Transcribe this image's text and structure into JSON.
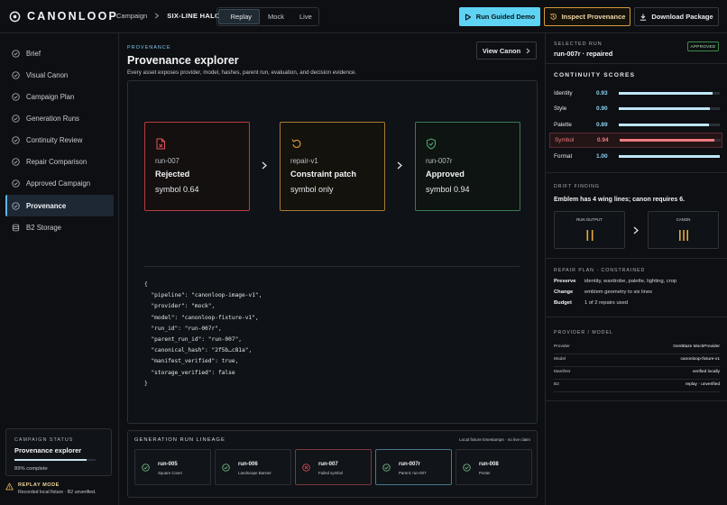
{
  "app": {
    "name": "CANONLOOP"
  },
  "breadcrumb": {
    "root": "Campaign",
    "current": "SIX-LINE HALO"
  },
  "modes": {
    "replay": "Replay",
    "mock": "Mock",
    "live": "Live",
    "active": "Replay"
  },
  "actions": {
    "guided": "Run Guided Demo",
    "inspect": "Inspect Provenance",
    "download": "Download Package"
  },
  "sidebar": {
    "items": [
      {
        "label": "Brief"
      },
      {
        "label": "Visual Canon"
      },
      {
        "label": "Campaign Plan"
      },
      {
        "label": "Generation Runs"
      },
      {
        "label": "Continuity Review"
      },
      {
        "label": "Repair Comparison"
      },
      {
        "label": "Approved Campaign"
      },
      {
        "label": "Provenance"
      },
      {
        "label": "B2 Storage"
      }
    ],
    "active": "Provenance",
    "status": {
      "kicker": "CAMPAIGN STATUS",
      "title": "Provenance explorer",
      "progress": 0.89,
      "progress_text": "89% complete"
    },
    "replay": {
      "title": "REPLAY MODE",
      "sub": "Recorded local fixture · B2 unverified."
    }
  },
  "main": {
    "kicker": "PROVENANCE",
    "title": "Provenance explorer",
    "subtitle": "Every asset exposes provider, model, hashes, parent run, evaluation, and decision evidence.",
    "view_canon": "View Canon",
    "cards": [
      {
        "run": "run-007",
        "title": "Rejected",
        "value": "symbol 0.64",
        "tone": "red"
      },
      {
        "run": "repair-v1",
        "title": "Constraint patch",
        "value": "symbol only",
        "tone": "amber"
      },
      {
        "run": "run-007r",
        "title": "Approved",
        "value": "symbol 0.94",
        "tone": "green"
      }
    ],
    "json_lines": [
      "{",
      "  \"pipeline\": \"canonloop-image-v1\",",
      "  \"provider\": \"mock\",",
      "  \"model\": \"canonloop-fixture-v1\",",
      "  \"run_id\": \"run-007r\",",
      "  \"parent_run_id\": \"run-007\",",
      "  \"canonical_hash\": \"2f5b…c81a\",",
      "  \"manifest_verified\": true,",
      "  \"storage_verified\": false",
      "}"
    ]
  },
  "lineage": {
    "title": "GENERATION RUN LINEAGE",
    "note": "Local fixture timestamps · no live claim",
    "runs": [
      {
        "id": "run-005",
        "sub": "Square Cover",
        "state": "ok"
      },
      {
        "id": "run-006",
        "sub": "Landscape Banner",
        "state": "ok"
      },
      {
        "id": "run-007",
        "sub": "Failed symbol",
        "state": "failed"
      },
      {
        "id": "run-007r",
        "sub": "Parent: run-007",
        "state": "selected"
      },
      {
        "id": "run-008",
        "sub": "Poster",
        "state": "ok"
      }
    ]
  },
  "right": {
    "selected_kicker": "SELECTED RUN",
    "selected_value": "run-007r · repaired",
    "badge": "APPROVED",
    "scores_title": "CONTINUITY SCORES",
    "scores": [
      {
        "name": "Identity",
        "value": "0.93",
        "v": 0.93,
        "flag": false
      },
      {
        "name": "Style",
        "value": "0.90",
        "v": 0.9,
        "flag": false
      },
      {
        "name": "Palette",
        "value": "0.89",
        "v": 0.89,
        "flag": false
      },
      {
        "name": "Symbol",
        "value": "0.94",
        "v": 0.94,
        "flag": true
      },
      {
        "name": "Format",
        "value": "1.00",
        "v": 1.0,
        "flag": false
      }
    ],
    "drift_kicker": "DRIFT FINDING",
    "drift_text": "Emblem has 4 wing lines; canon requires 6.",
    "run_output_label": "RUN OUTPUT",
    "canon_label": "CANON",
    "repair_kicker": "REPAIR PLAN · CONSTRAINED",
    "repair_rows": [
      {
        "k": "Preserve",
        "v": "identity, wardrobe, palette, lighting, crop"
      },
      {
        "k": "Change",
        "v": "emblem geometry to six lines"
      },
      {
        "k": "Budget",
        "v": "1 of 2 repairs used"
      }
    ],
    "provider_kicker": "PROVIDER / MODEL",
    "provider_rows": [
      {
        "k": "Provider",
        "v": "GenBlaze MockProvider"
      },
      {
        "k": "Model",
        "v": "canonloop-fixture-v1"
      },
      {
        "k": "Manifest",
        "v": "verified locally"
      },
      {
        "k": "B2",
        "v": "replay · unverified"
      }
    ]
  },
  "colors": {
    "accent": "#5fd3f3",
    "amber": "#d59a3a",
    "danger": "#f07a80",
    "success": "#3d8a4a"
  }
}
